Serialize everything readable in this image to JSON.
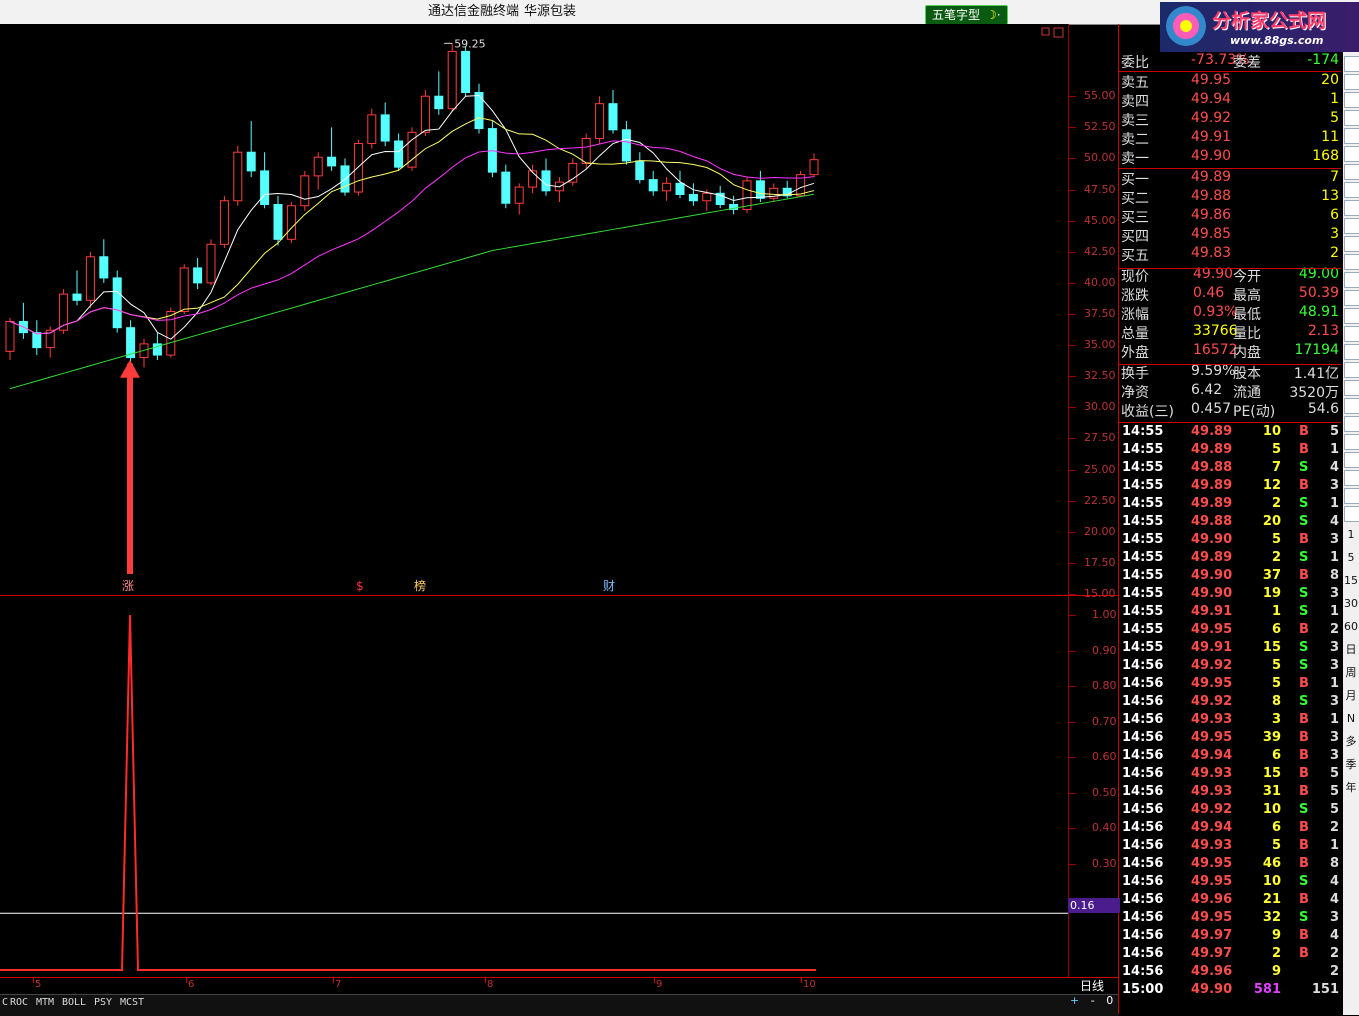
{
  "window": {
    "title_app": "通达信金融终端",
    "title_stock": "华源包装"
  },
  "toolbar_button": {
    "label": "五笔字型",
    "glyph": "·"
  },
  "logo": {
    "name": "分析家公式网",
    "url": "www.88gs.com"
  },
  "main_chart": {
    "high_marker": "59.25",
    "yticks": [
      "55.00",
      "52.50",
      "50.00",
      "47.50",
      "45.00",
      "42.50",
      "40.00",
      "37.50",
      "35.00",
      "32.50",
      "30.00",
      "27.50",
      "25.00",
      "22.50",
      "20.00",
      "17.50",
      "15.00"
    ],
    "events": [
      {
        "label": "涨",
        "color": "#ff8a8a"
      },
      {
        "label": "$",
        "color": "#ff3030"
      },
      {
        "label": "榜",
        "color": "#ffcc66"
      },
      {
        "label": "财",
        "color": "#7fbfff"
      }
    ]
  },
  "indicator": {
    "yticks": [
      "1.00",
      "0.90",
      "0.80",
      "0.70",
      "0.60",
      "0.50",
      "0.40",
      "0.30"
    ],
    "current_value": "0.16",
    "value_color": "#4b1c8c"
  },
  "x_axis": {
    "labels": [
      "5",
      "6",
      "7",
      "8",
      "9",
      "10"
    ],
    "period": "日线"
  },
  "tabs": [
    "C",
    "ROC",
    "MTM",
    "BOLL",
    "PSY",
    "MCST"
  ],
  "nav": {
    "plus": "+",
    "minus": "-",
    "zero": "0"
  },
  "quote": {
    "webi": {
      "label": "委比",
      "value": "-73.73%",
      "label2": "委差",
      "value2": "-174"
    },
    "asks": [
      {
        "label": "卖五",
        "price": "49.95",
        "vol": "20"
      },
      {
        "label": "卖四",
        "price": "49.94",
        "vol": "1"
      },
      {
        "label": "卖三",
        "price": "49.92",
        "vol": "5"
      },
      {
        "label": "卖二",
        "price": "49.91",
        "vol": "11"
      },
      {
        "label": "卖一",
        "price": "49.90",
        "vol": "168"
      }
    ],
    "bids": [
      {
        "label": "买一",
        "price": "49.89",
        "vol": "7"
      },
      {
        "label": "买二",
        "price": "49.88",
        "vol": "13"
      },
      {
        "label": "买三",
        "price": "49.86",
        "vol": "6"
      },
      {
        "label": "买四",
        "price": "49.85",
        "vol": "3"
      },
      {
        "label": "买五",
        "price": "49.83",
        "vol": "2"
      }
    ],
    "stats": [
      {
        "l1": "现价",
        "v1": "49.90",
        "c1": "red",
        "l2": "今开",
        "v2": "49.00",
        "c2": "grn"
      },
      {
        "l1": "涨跌",
        "v1": "0.46",
        "c1": "red",
        "l2": "最高",
        "v2": "50.39",
        "c2": "red"
      },
      {
        "l1": "涨幅",
        "v1": "0.93%",
        "c1": "red",
        "l2": "最低",
        "v2": "48.91",
        "c2": "grn"
      },
      {
        "l1": "总量",
        "v1": "33766",
        "c1": "yel",
        "l2": "量比",
        "v2": "2.13",
        "c2": "red"
      },
      {
        "l1": "外盘",
        "v1": "16572",
        "c1": "red",
        "l2": "内盘",
        "v2": "17194",
        "c2": "grn"
      }
    ],
    "info": [
      {
        "l1": "换手",
        "v1": "9.59%",
        "l2": "股本",
        "v2": "1.41亿"
      },
      {
        "l1": "净资",
        "v1": "6.42",
        "l2": "流通",
        "v2": "3520万"
      },
      {
        "l1": "收益(三)",
        "v1": "0.457",
        "l2": "PE(动)",
        "v2": "54.6"
      }
    ]
  },
  "trades": [
    {
      "time": "14:55",
      "price": "49.89",
      "vol": "10",
      "side": "B",
      "n": "5"
    },
    {
      "time": "14:55",
      "price": "49.89",
      "vol": "5",
      "side": "B",
      "n": "1"
    },
    {
      "time": "14:55",
      "price": "49.88",
      "vol": "7",
      "side": "S",
      "n": "4"
    },
    {
      "time": "14:55",
      "price": "49.89",
      "vol": "12",
      "side": "B",
      "n": "3"
    },
    {
      "time": "14:55",
      "price": "49.89",
      "vol": "2",
      "side": "S",
      "n": "1"
    },
    {
      "time": "14:55",
      "price": "49.88",
      "vol": "20",
      "side": "S",
      "n": "4"
    },
    {
      "time": "14:55",
      "price": "49.90",
      "vol": "5",
      "side": "B",
      "n": "3"
    },
    {
      "time": "14:55",
      "price": "49.89",
      "vol": "2",
      "side": "S",
      "n": "1"
    },
    {
      "time": "14:55",
      "price": "49.90",
      "vol": "37",
      "side": "B",
      "n": "8"
    },
    {
      "time": "14:55",
      "price": "49.90",
      "vol": "19",
      "side": "S",
      "n": "3"
    },
    {
      "time": "14:55",
      "price": "49.91",
      "vol": "1",
      "side": "S",
      "n": "1"
    },
    {
      "time": "14:55",
      "price": "49.95",
      "vol": "6",
      "side": "B",
      "n": "2"
    },
    {
      "time": "14:55",
      "price": "49.91",
      "vol": "15",
      "side": "S",
      "n": "3"
    },
    {
      "time": "14:56",
      "price": "49.92",
      "vol": "5",
      "side": "S",
      "n": "3"
    },
    {
      "time": "14:56",
      "price": "49.95",
      "vol": "5",
      "side": "B",
      "n": "1"
    },
    {
      "time": "14:56",
      "price": "49.92",
      "vol": "8",
      "side": "S",
      "n": "3"
    },
    {
      "time": "14:56",
      "price": "49.93",
      "vol": "3",
      "side": "B",
      "n": "1"
    },
    {
      "time": "14:56",
      "price": "49.95",
      "vol": "39",
      "side": "B",
      "n": "3"
    },
    {
      "time": "14:56",
      "price": "49.94",
      "vol": "6",
      "side": "B",
      "n": "3"
    },
    {
      "time": "14:56",
      "price": "49.93",
      "vol": "15",
      "side": "B",
      "n": "5"
    },
    {
      "time": "14:56",
      "price": "49.93",
      "vol": "31",
      "side": "B",
      "n": "5"
    },
    {
      "time": "14:56",
      "price": "49.92",
      "vol": "10",
      "side": "S",
      "n": "5"
    },
    {
      "time": "14:56",
      "price": "49.94",
      "vol": "6",
      "side": "B",
      "n": "2"
    },
    {
      "time": "14:56",
      "price": "49.93",
      "vol": "5",
      "side": "B",
      "n": "1"
    },
    {
      "time": "14:56",
      "price": "49.95",
      "vol": "46",
      "side": "B",
      "n": "8"
    },
    {
      "time": "14:56",
      "price": "49.95",
      "vol": "10",
      "side": "S",
      "n": "4"
    },
    {
      "time": "14:56",
      "price": "49.96",
      "vol": "21",
      "side": "B",
      "n": "4"
    },
    {
      "time": "14:56",
      "price": "49.95",
      "vol": "32",
      "side": "S",
      "n": "3"
    },
    {
      "time": "14:56",
      "price": "49.97",
      "vol": "9",
      "side": "B",
      "n": "4"
    },
    {
      "time": "14:56",
      "price": "49.97",
      "vol": "2",
      "side": "B",
      "n": "2"
    },
    {
      "time": "14:56",
      "price": "49.96",
      "vol": "9",
      "side": "",
      "n": "2"
    },
    {
      "time": "15:00",
      "price": "49.90",
      "vol": "581",
      "side": "",
      "n": "151"
    }
  ],
  "side_toolbar": [
    "1",
    "5",
    "15",
    "30",
    "60",
    "日",
    "周",
    "月",
    "N",
    "多",
    "季",
    "年"
  ],
  "chart_data": {
    "type": "candlestick",
    "y_axis_range": [
      15.0,
      60.0
    ],
    "candles_approx": [
      [
        34.5,
        37.2,
        33.8,
        36.9
      ],
      [
        36.9,
        38.4,
        35.5,
        36.0
      ],
      [
        36.0,
        37.0,
        34.2,
        34.8
      ],
      [
        34.8,
        36.5,
        34.0,
        36.2
      ],
      [
        36.2,
        39.5,
        35.9,
        39.1
      ],
      [
        39.1,
        41.0,
        38.2,
        38.6
      ],
      [
        38.6,
        42.5,
        38.0,
        42.1
      ],
      [
        42.1,
        43.5,
        40.0,
        40.4
      ],
      [
        40.4,
        41.0,
        36.0,
        36.4
      ],
      [
        36.4,
        37.0,
        33.5,
        34.0
      ],
      [
        34.0,
        35.5,
        33.2,
        35.1
      ],
      [
        35.1,
        36.0,
        33.8,
        34.2
      ],
      [
        34.2,
        38.0,
        34.0,
        37.7
      ],
      [
        37.7,
        41.5,
        37.5,
        41.2
      ],
      [
        41.2,
        42.0,
        39.5,
        40.0
      ],
      [
        40.0,
        43.5,
        39.8,
        43.1
      ],
      [
        43.1,
        47.0,
        42.8,
        46.6
      ],
      [
        46.6,
        51.0,
        46.2,
        50.5
      ],
      [
        50.5,
        53.0,
        48.5,
        49.0
      ],
      [
        49.0,
        50.5,
        46.0,
        46.3
      ],
      [
        46.3,
        47.0,
        43.0,
        43.5
      ],
      [
        43.5,
        46.5,
        43.2,
        46.2
      ],
      [
        46.2,
        49.0,
        45.8,
        48.6
      ],
      [
        48.6,
        50.5,
        47.5,
        50.1
      ],
      [
        50.1,
        52.5,
        49.0,
        49.4
      ],
      [
        49.4,
        50.0,
        47.0,
        47.3
      ],
      [
        47.3,
        51.5,
        47.0,
        51.2
      ],
      [
        51.2,
        54.0,
        50.8,
        53.5
      ],
      [
        53.5,
        54.5,
        51.0,
        51.4
      ],
      [
        51.4,
        52.0,
        49.0,
        49.3
      ],
      [
        49.3,
        52.5,
        49.0,
        52.1
      ],
      [
        52.1,
        55.5,
        51.8,
        55.0
      ],
      [
        55.0,
        57.0,
        53.5,
        54.0
      ],
      [
        54.0,
        59.25,
        53.8,
        58.6
      ],
      [
        58.6,
        59.0,
        55.0,
        55.3
      ],
      [
        55.3,
        56.0,
        52.0,
        52.4
      ],
      [
        52.4,
        53.0,
        48.5,
        48.9
      ],
      [
        48.9,
        49.5,
        46.0,
        46.4
      ],
      [
        46.4,
        48.0,
        45.5,
        47.7
      ],
      [
        47.7,
        49.5,
        47.2,
        49.0
      ],
      [
        49.0,
        50.0,
        47.0,
        47.4
      ],
      [
        47.4,
        48.5,
        46.5,
        48.1
      ],
      [
        48.1,
        50.0,
        47.8,
        49.6
      ],
      [
        49.6,
        52.0,
        49.2,
        51.6
      ],
      [
        51.6,
        55.0,
        51.2,
        54.4
      ],
      [
        54.4,
        55.5,
        52.0,
        52.3
      ],
      [
        52.3,
        53.0,
        49.5,
        49.8
      ],
      [
        49.8,
        50.5,
        48.0,
        48.3
      ],
      [
        48.3,
        49.0,
        47.0,
        47.4
      ],
      [
        47.4,
        48.5,
        46.6,
        48.0
      ],
      [
        48.0,
        49.0,
        46.8,
        47.1
      ],
      [
        47.1,
        48.0,
        46.2,
        46.6
      ],
      [
        46.6,
        47.5,
        45.8,
        47.2
      ],
      [
        47.2,
        47.8,
        46.0,
        46.3
      ],
      [
        46.3,
        47.0,
        45.5,
        45.9
      ],
      [
        45.9,
        48.5,
        45.6,
        48.2
      ],
      [
        48.2,
        49.0,
        46.5,
        46.8
      ],
      [
        46.8,
        48.0,
        46.5,
        47.6
      ],
      [
        47.6,
        48.2,
        46.8,
        47.0
      ],
      [
        47.0,
        49.0,
        46.9,
        48.7
      ],
      [
        48.7,
        50.4,
        48.5,
        49.9
      ]
    ]
  }
}
